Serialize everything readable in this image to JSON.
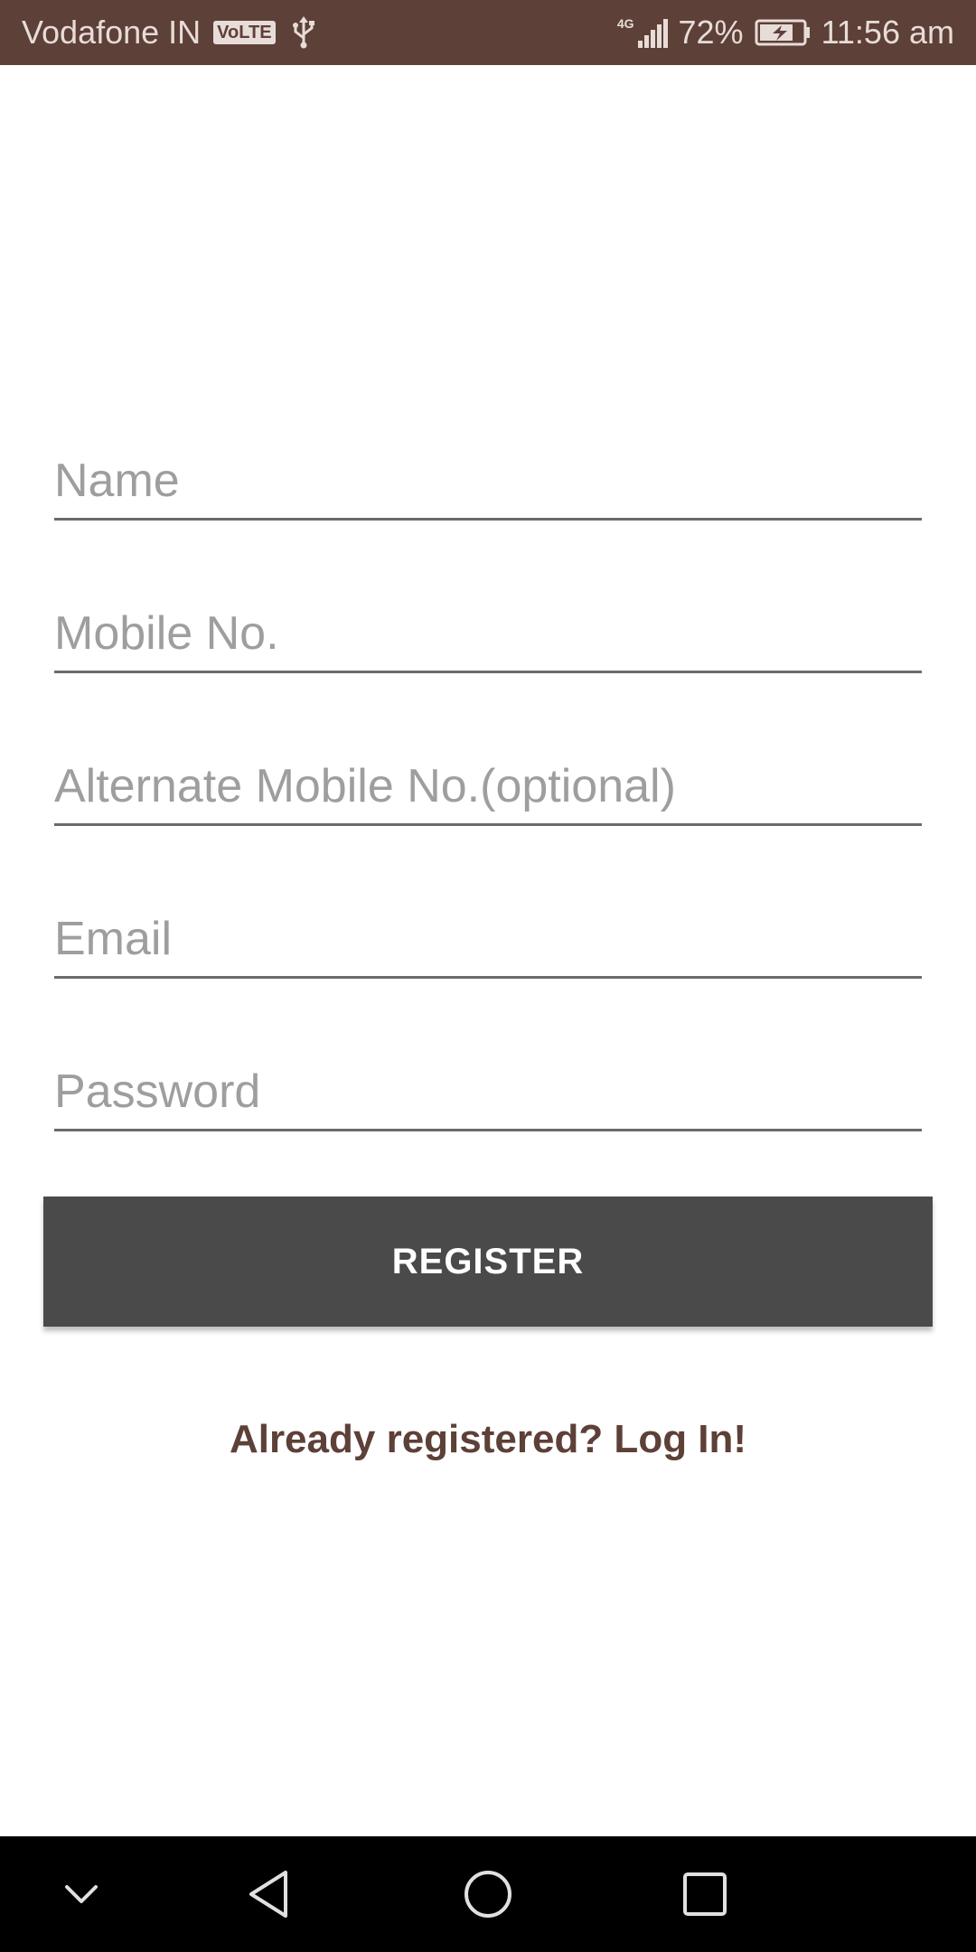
{
  "status_bar": {
    "carrier": "Vodafone IN",
    "volte": "VoLTE",
    "network_type": "4G",
    "battery": "72%",
    "time": "11:56 am",
    "icons": [
      "volte-icon",
      "usb-icon",
      "signal-icon",
      "battery-charging-icon"
    ]
  },
  "form": {
    "name_placeholder": "Name",
    "mobile_placeholder": "Mobile No.",
    "alt_mobile_placeholder": "Alternate Mobile No.(optional)",
    "email_placeholder": "Email",
    "password_placeholder": "Password",
    "register_label": "REGISTER"
  },
  "login_link": "Already registered? Log In!",
  "nav_bar": {
    "icons": [
      "chevron-down-icon",
      "back-icon",
      "home-icon",
      "recents-icon"
    ]
  },
  "colors": {
    "status_bar": "#5d4037",
    "button": "#4a4a4a",
    "link": "#5d4037",
    "nav_bar": "#000000"
  }
}
